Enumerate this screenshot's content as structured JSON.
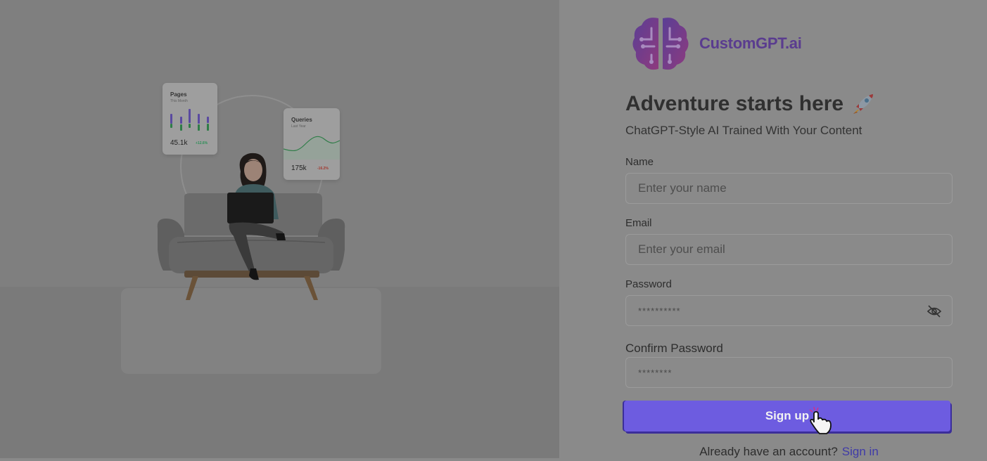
{
  "illustration": {
    "pages_card": {
      "title": "Pages",
      "subtitle": "This Month",
      "value": "45.1k",
      "delta": "+12.6%"
    },
    "queries_card": {
      "title": "Queries",
      "subtitle": "Last Year",
      "value": "175k",
      "delta": "-16.2%"
    }
  },
  "brand": {
    "name": "CustomGPT.ai"
  },
  "form": {
    "heading": "Adventure starts here",
    "subtitle": "ChatGPT-Style AI Trained With Your Content",
    "name_label": "Name",
    "name_placeholder": "Enter your name",
    "email_label": "Email",
    "email_placeholder": "Enter your email",
    "password_label": "Password",
    "password_value": "**********",
    "confirm_label": "Confirm Password",
    "confirm_value": "********",
    "submit_label": "Sign up",
    "footer_text": "Already have an account?",
    "signin_label": "Sign in"
  },
  "colors": {
    "accent": "#6d5ce0",
    "overlay": "#8a8a8a"
  },
  "icons": [
    "brain-logo-icon",
    "rocket-icon",
    "eye-off-icon",
    "hand-cursor-icon"
  ]
}
